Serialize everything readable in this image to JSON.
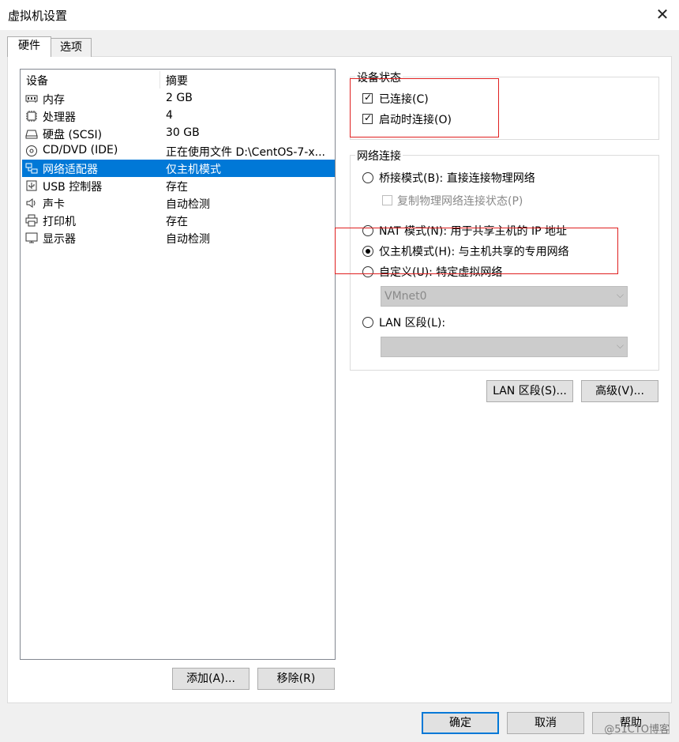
{
  "window": {
    "title": "虚拟机设置",
    "close_glyph": "✕"
  },
  "tabs": [
    {
      "label": "硬件"
    },
    {
      "label": "选项"
    }
  ],
  "device_list": {
    "col_device": "设备",
    "col_summary": "摘要",
    "rows": [
      {
        "name": "内存",
        "summary": "2 GB",
        "icon": "memory-icon"
      },
      {
        "name": "处理器",
        "summary": "4",
        "icon": "cpu-icon"
      },
      {
        "name": "硬盘 (SCSI)",
        "summary": "30 GB",
        "icon": "harddisk-icon"
      },
      {
        "name": "CD/DVD (IDE)",
        "summary": "正在使用文件 D:\\CentOS-7-x...",
        "icon": "cd-dvd-icon"
      },
      {
        "name": "网络适配器",
        "summary": "仅主机模式",
        "icon": "network-adapter-icon"
      },
      {
        "name": "USB 控制器",
        "summary": "存在",
        "icon": "usb-icon"
      },
      {
        "name": "声卡",
        "summary": "自动检测",
        "icon": "sound-icon"
      },
      {
        "name": "打印机",
        "summary": "存在",
        "icon": "printer-icon"
      },
      {
        "name": "显示器",
        "summary": "自动检测",
        "icon": "display-icon"
      }
    ],
    "add_button": "添加(A)...",
    "remove_button": "移除(R)"
  },
  "device_status": {
    "legend": "设备状态",
    "connected": {
      "label": "已连接(C)",
      "checked": true
    },
    "connect_on_power": {
      "label": "启动时连接(O)",
      "checked": true
    }
  },
  "network": {
    "legend": "网络连接",
    "bridged": "桥接模式(B): 直接连接物理网络",
    "replicate": "复制物理网络连接状态(P)",
    "nat": "NAT 模式(N): 用于共享主机的 IP 地址",
    "host_only": "仅主机模式(H): 与主机共享的专用网络",
    "custom": "自定义(U): 特定虚拟网络",
    "custom_value": "VMnet0",
    "lan": "LAN 区段(L):",
    "lan_value": "",
    "selected": "host_only"
  },
  "buttons": {
    "lan_segments": "LAN 区段(S)...",
    "advanced": "高级(V)...",
    "ok": "确定",
    "cancel": "取消",
    "help": "帮助"
  },
  "watermark": "@51CTO博客",
  "colors": {
    "selection": "#0078d7",
    "annotation": "#e02020"
  }
}
